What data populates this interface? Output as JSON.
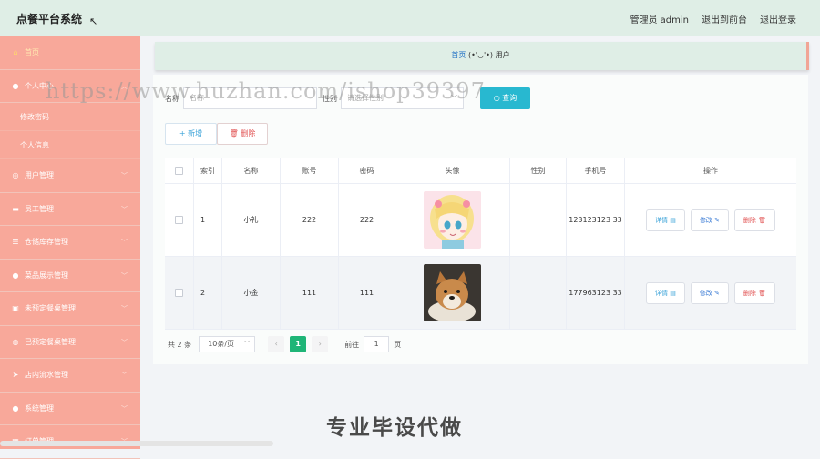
{
  "app": {
    "title": "点餐平台系统",
    "admin_label": "管理员 admin",
    "to_front": "退出到前台",
    "logout": "退出登录"
  },
  "sidebar": {
    "items": [
      {
        "label": "首页",
        "icon": "home-icon",
        "active": true
      },
      {
        "label": "个人中心",
        "icon": "user-icon"
      },
      {
        "label": "用户管理",
        "icon": "compass-icon"
      },
      {
        "label": "员工管理",
        "icon": "chat-icon"
      },
      {
        "label": "仓储库存管理",
        "icon": "list-icon"
      },
      {
        "label": "菜品展示管理",
        "icon": "user-icon"
      },
      {
        "label": "未预定餐桌管理",
        "icon": "clipboard-icon"
      },
      {
        "label": "已预定餐桌管理",
        "icon": "coffee-icon"
      },
      {
        "label": "店内流水管理",
        "icon": "send-icon"
      },
      {
        "label": "系统管理",
        "icon": "user-icon"
      },
      {
        "label": "订单管理",
        "icon": "grid-icon"
      }
    ],
    "sub_items": [
      "修改密码",
      "个人信息"
    ]
  },
  "breadcrumb": {
    "home": "首页",
    "face": "(•'◡'•)",
    "current": "用户"
  },
  "search": {
    "name_label": "名称",
    "name_placeholder": "名称",
    "gender_label": "性别",
    "gender_placeholder": "请选择性别",
    "query_button": "查询"
  },
  "actions": {
    "add": "新增",
    "delete": "删除"
  },
  "table": {
    "headers": [
      "索引",
      "名称",
      "账号",
      "密码",
      "头像",
      "性别",
      "手机号",
      "操作"
    ],
    "rows": [
      {
        "index": "1",
        "name": "小礼",
        "account": "222",
        "password": "222",
        "gender": "",
        "phone": "123123123 33",
        "avatar": "anime-girl"
      },
      {
        "index": "2",
        "name": "小金",
        "account": "111",
        "password": "111",
        "gender": "",
        "phone": "177963123 33",
        "avatar": "shiba-dog"
      }
    ],
    "op_detail": "详情",
    "op_edit": "修改",
    "op_remove": "删除"
  },
  "pager": {
    "total": "共 2 条",
    "page_size": "10条/页",
    "current_page": "1",
    "goto_prefix": "前往",
    "goto_value": "1",
    "goto_suffix": "页"
  },
  "overlay": {
    "watermark": "https://www.huzhan.com/ishop39397",
    "promo": "专业毕设代做"
  },
  "colors": {
    "topbar": "#dfeee6",
    "sidebar": "#f8a89a",
    "primary_query": "#28b8d0",
    "page_active": "#1fb577",
    "danger": "#e25656"
  }
}
